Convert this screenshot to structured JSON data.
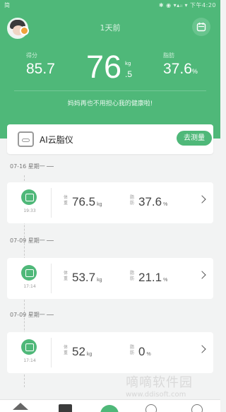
{
  "status_bar": {
    "left": "简",
    "right": "✱ ◉ ▾▴ᵢₗ ▾ 下午4:20"
  },
  "header": {
    "date": "1天前"
  },
  "summary": {
    "score_label": "得分",
    "score_value": "85.7",
    "weight_int": "76",
    "weight_unit": "kg",
    "weight_dec": ".5",
    "fat_label": "脂肪",
    "fat_value": "37.6",
    "fat_unit": "%",
    "slogan": "妈妈再也不用担心我的健康啦!"
  },
  "device": {
    "name": "AI云脂仪",
    "measure_button": "去测量"
  },
  "records": [
    {
      "date": "07-16 星期一",
      "time": "19:33",
      "weight_label": "体重",
      "weight": "76.5",
      "weight_unit": "kg",
      "fat_label": "脂肪",
      "fat": "37.6",
      "fat_unit": "%"
    },
    {
      "date": "07-09 星期一",
      "time": "17:14",
      "weight_label": "体重",
      "weight": "53.7",
      "weight_unit": "kg",
      "fat_label": "脂肪",
      "fat": "21.1",
      "fat_unit": "%"
    },
    {
      "date": "07-09 星期一",
      "time": "17:14",
      "weight_label": "体重",
      "weight": "52",
      "weight_unit": "kg",
      "fat_label": "脂肪",
      "fat": "0",
      "fat_unit": "%"
    }
  ],
  "watermark": {
    "cn": "嘀嘀软件园",
    "url": "www.ddisoft.com"
  },
  "colors": {
    "brand_green": "#4fb879",
    "background": "#f2f3f3"
  },
  "icons": [
    "calendar-icon",
    "scale-icon",
    "chevron-right-icon",
    "home-icon",
    "send-icon",
    "profile-icon"
  ]
}
